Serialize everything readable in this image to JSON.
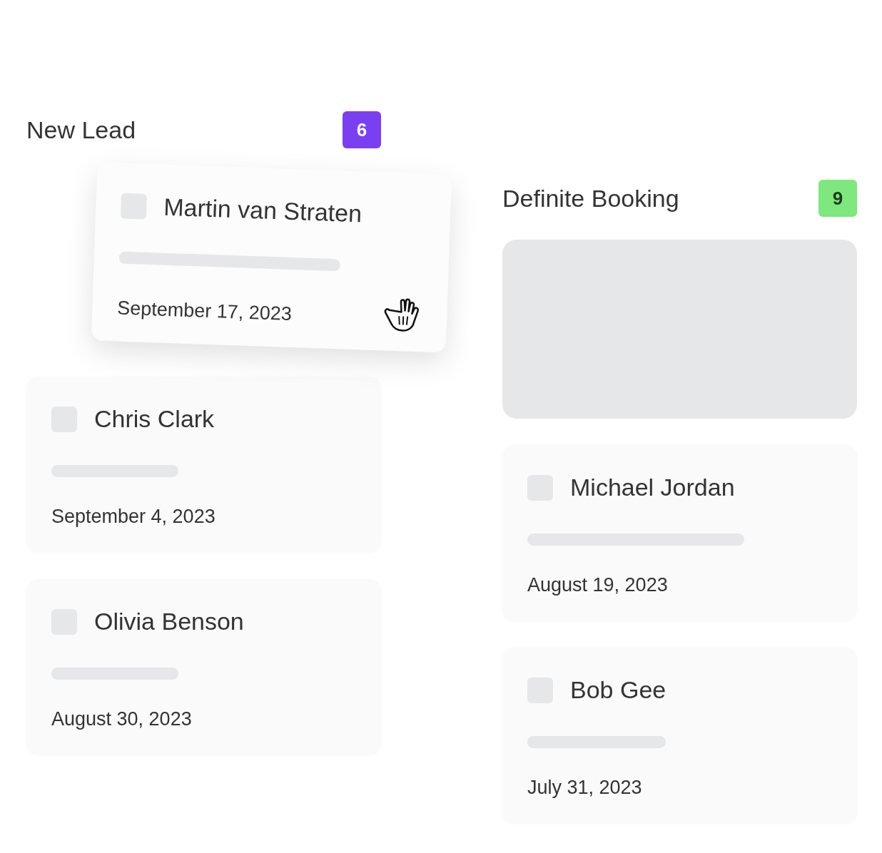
{
  "columns": [
    {
      "title": "New Lead",
      "count": "6",
      "color": "#7b3ff2",
      "cards": [
        {
          "kind": "dragging",
          "name": "Martin van Straten",
          "date": "September 17, 2023",
          "checked": false
        },
        {
          "kind": "card",
          "name": "Chris Clark",
          "date": "September 4, 2023",
          "checked": false
        },
        {
          "kind": "card",
          "name": "Olivia Benson",
          "date": "August 30, 2023",
          "checked": false
        }
      ]
    },
    {
      "title": "Definite Booking",
      "count": "9",
      "color": "#7ee87e",
      "cards": [
        {
          "kind": "placeholder"
        },
        {
          "kind": "card",
          "name": "Michael Jordan",
          "date": "August 19, 2023",
          "checked": false
        },
        {
          "kind": "card",
          "name": "Bob Gee",
          "date": "July 31, 2023",
          "checked": false
        }
      ]
    }
  ]
}
